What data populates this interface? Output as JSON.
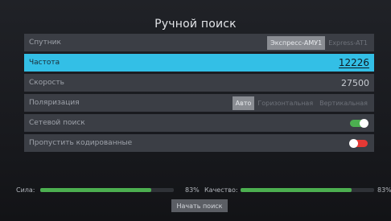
{
  "title": "Ручной поиск",
  "rows": {
    "satellite": {
      "label": "Спутник",
      "options": [
        "Экспресс-АМУ1",
        "Express-AT1"
      ],
      "selected": 0
    },
    "frequency": {
      "label": "Частота",
      "value": "12226"
    },
    "symbol_rate": {
      "label": "Скорость",
      "value": "27500"
    },
    "polarization": {
      "label": "Поляризация",
      "options": [
        "Авто",
        "Горизонтальная",
        "Вертикальная"
      ],
      "selected": 0
    },
    "network_search": {
      "label": "Сетевой поиск",
      "state": "on"
    },
    "skip_encrypted": {
      "label": "Пропустить кодированные",
      "state": "off"
    }
  },
  "signal": {
    "strength_label": "Сила:",
    "strength_value": "83%",
    "strength_fraction": 0.83,
    "quality_label": "Качество:",
    "quality_value": "83%",
    "quality_fraction": 0.83
  },
  "start_button": "Начать поиск",
  "colors": {
    "accent": "#33bfe6",
    "toggle_on": "#4caf50",
    "toggle_off": "#e53935",
    "meter": "#4caf50"
  }
}
